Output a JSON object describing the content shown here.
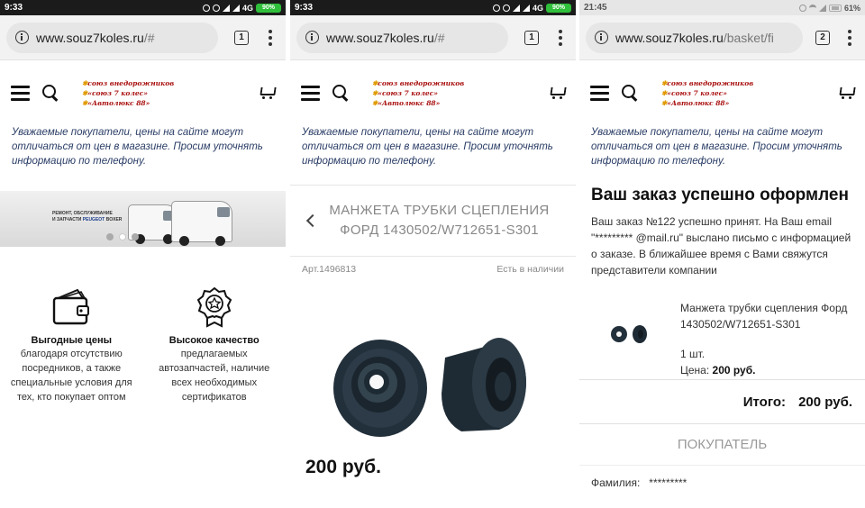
{
  "panels": [
    {
      "status": {
        "time": "9:33",
        "network": "4G",
        "battery": "90%"
      },
      "browser": {
        "host": "www.souz7koles.ru",
        "path": "/#",
        "tab_count": "1"
      },
      "logo": {
        "line1": "союз внедорожников",
        "line2": "«союз 7 колес»",
        "line3": "«Автолюкс 88»"
      },
      "notice": "Уважаемые покупатели, цены на сайте могут отличаться от цен в магазине. Просим уточнять информацию по телефону.",
      "banner": {
        "line1": "РЕМОНТ, ОБСЛУЖИВАНИЕ",
        "line2a": "И ЗАПЧАСТИ ",
        "brand": "PEUGEOT",
        "model": " BOXER"
      },
      "features": [
        {
          "icon": "wallet-icon",
          "title": "Выгодные цены",
          "text": "благодаря отсутствию посредников, а также специальные условия для тех, кто покупает оптом"
        },
        {
          "icon": "quality-badge-icon",
          "title": "Высокое качество",
          "text": "предлагаемых автозапчастей, наличие всех необходимых сертификатов"
        }
      ]
    },
    {
      "status": {
        "time": "9:33",
        "network": "4G",
        "battery": "90%"
      },
      "browser": {
        "host": "www.souz7koles.ru",
        "path": "/#",
        "tab_count": "1"
      },
      "product": {
        "title": "МАНЖЕТА ТРУБКИ СЦЕПЛЕНИЯ ФОРД 1430502/W712651-S301",
        "article": "Арт.1496813",
        "availability": "Есть в наличии",
        "price": "200 руб."
      }
    },
    {
      "status": {
        "time": "21:45",
        "battery": "61%"
      },
      "browser": {
        "host": "www.souz7koles.ru",
        "path": "/basket/fi",
        "tab_count": "2"
      },
      "order": {
        "title": "Ваш заказ успешно оформлен",
        "text": "Ваш заказ №122 успешно принят. На Ваш email \"********* @mail.ru\" выслано письмо с информацией о заказе. В ближайшее время с Вами свяжутся представители компании",
        "item_name": "Манжета трубки сцепления Форд 1430502/W712651-S301",
        "qty": "1 шт.",
        "price_label": "Цена:",
        "price": "200 руб.",
        "total_label": "Итого:",
        "total": "200 руб.",
        "buyer_header": "ПОКУПАТЕЛЬ",
        "surname_label": "Фамилия:",
        "surname_value": "*********"
      }
    }
  ],
  "colors": {
    "logo_red": "#a8100f",
    "notice_text": "#2a3d66",
    "battery_green": "#2fbf3a"
  }
}
